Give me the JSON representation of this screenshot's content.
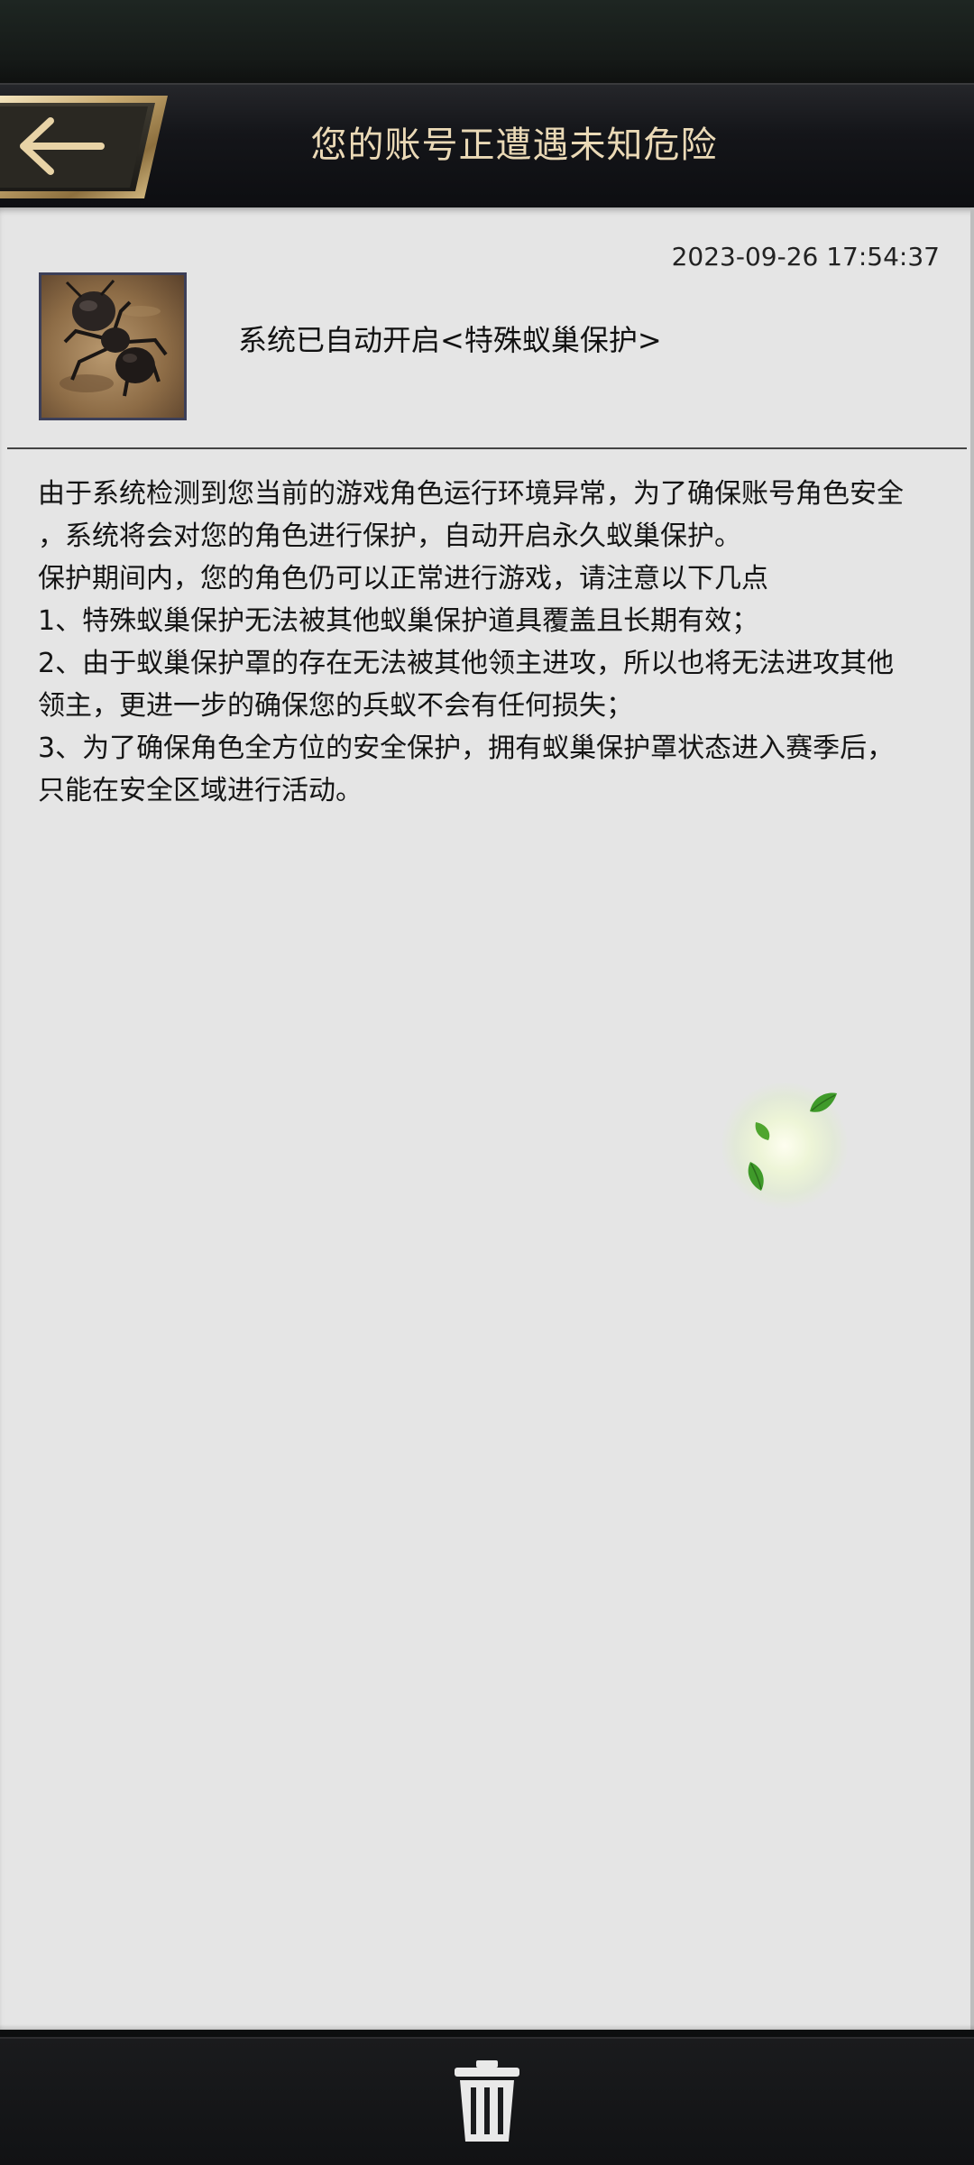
{
  "header": {
    "title": "您的账号正遭遇未知危险",
    "back_icon": "back-arrow-icon"
  },
  "mail": {
    "timestamp": "2023-09-26 17:54:37",
    "avatar_icon": "ant-avatar-icon",
    "subject": "系统已自动开启<特殊蚁巢保护>",
    "body_lines": [
      "由于系统检测到您当前的游戏角色运行环境异常，为了确保账号角色安全",
      "，系统将会对您的角色进行保护，自动开启永久蚁巢保护。",
      "保护期间内，您的角色仍可以正常进行游戏，请注意以下几点",
      "1、特殊蚁巢保护无法被其他蚁巢保护道具覆盖且长期有效；",
      "2、由于蚁巢保护罩的存在无法被其他领主进攻，所以也将无法进攻其他",
      "领主，更进一步的确保您的兵蚁不会有任何损失；",
      "3、为了确保角色全方位的安全保护，拥有蚁巢保护罩状态进入赛季后，",
      "只能在安全区域进行活动。"
    ]
  },
  "footer": {
    "delete_icon": "trash-icon"
  },
  "colors": {
    "title_gold": "#ead9b6",
    "panel_bg": "#e5e5e5",
    "header_bg": "#141519",
    "leaf_green": "#4fa52e"
  }
}
